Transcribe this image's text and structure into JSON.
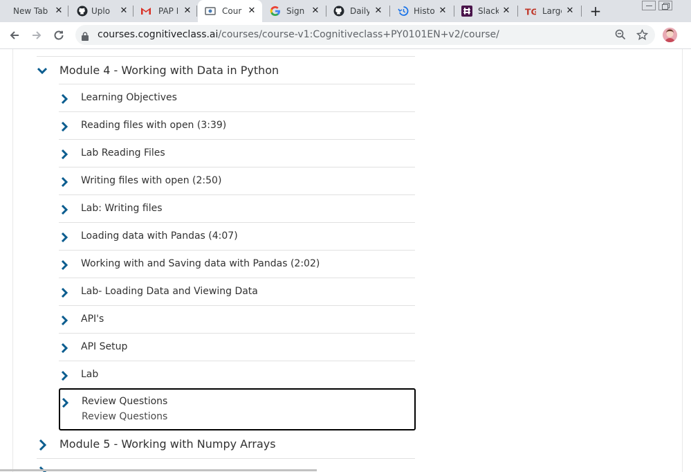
{
  "browser": {
    "tabs": [
      {
        "title": "New Tab",
        "icon": "none"
      },
      {
        "title": "Uplo",
        "icon": "github-icon"
      },
      {
        "title": "PAP I",
        "icon": "gmail-icon"
      },
      {
        "title": "Cour",
        "icon": "course-icon",
        "active": true
      },
      {
        "title": "Sign",
        "icon": "google-icon"
      },
      {
        "title": "Daily",
        "icon": "github-icon"
      },
      {
        "title": "Histo",
        "icon": "history-icon"
      },
      {
        "title": "Slack",
        "icon": "slack-icon"
      },
      {
        "title": "Large",
        "icon": "tg-icon"
      }
    ],
    "close_glyph": "✕",
    "new_tab_glyph": "+",
    "address": {
      "host": "courses.cognitiveclass.ai",
      "path": "/courses/course-v1:Cognitiveclass+PY0101EN+v2/course/"
    }
  },
  "course": {
    "module4": {
      "title": "Module 4 - Working with Data in Python",
      "items": [
        "Learning Objectives",
        "Reading files with open (3:39)",
        "Lab Reading Files",
        "Writing files with open (2:50)",
        "Lab: Writing files",
        "Loading data with Pandas (4:07)",
        "Working with and Saving data with Pandas (2:02)",
        "Lab- Loading Data and Viewing Data",
        "API's",
        "API Setup",
        "Lab"
      ],
      "focused_item": {
        "title": "Review Questions",
        "subtitle": "Review Questions"
      }
    },
    "module5": {
      "title": "Module 5 - Working with Numpy Arrays"
    }
  },
  "colors": {
    "accent_chevron": "#0b5d8f",
    "text": "#313131",
    "tab_strip": "#dee1e6"
  }
}
